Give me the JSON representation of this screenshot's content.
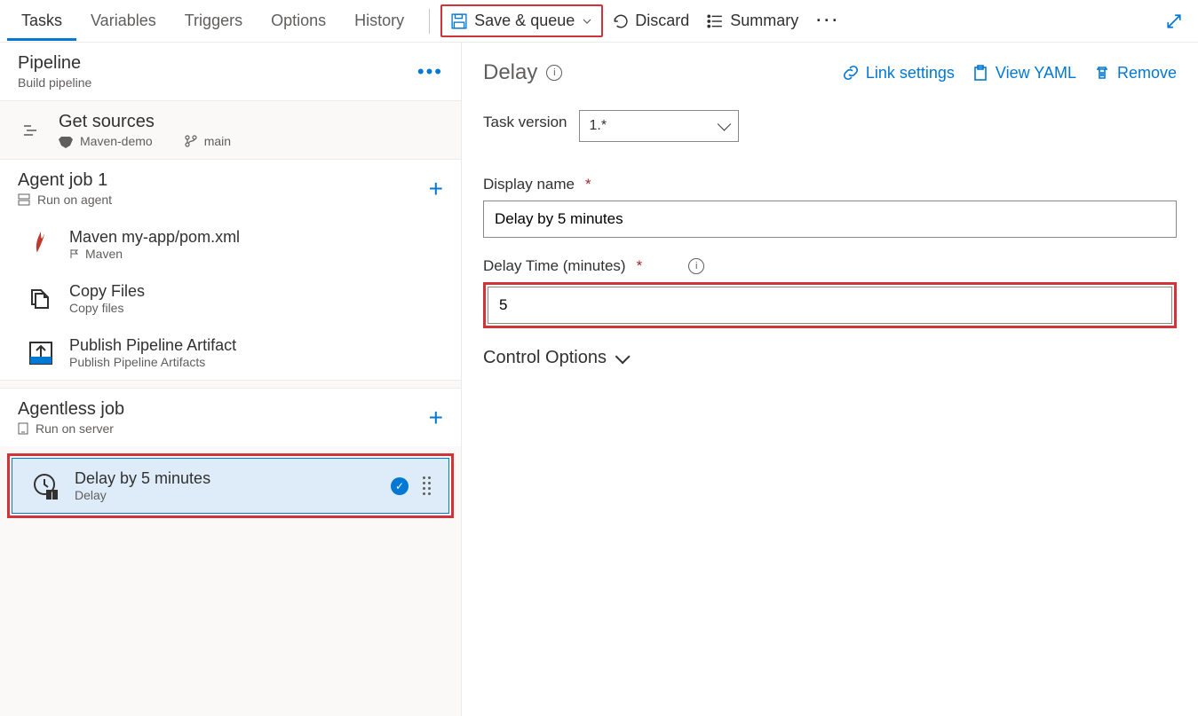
{
  "tabs": [
    "Tasks",
    "Variables",
    "Triggers",
    "Options",
    "History"
  ],
  "active_tab": 0,
  "toolbar": {
    "save_queue": "Save & queue",
    "discard": "Discard",
    "summary": "Summary"
  },
  "pipeline": {
    "title": "Pipeline",
    "subtitle": "Build pipeline"
  },
  "get_sources": {
    "title": "Get sources",
    "repo": "Maven-demo",
    "branch": "main"
  },
  "agent_job": {
    "title": "Agent job 1",
    "subtitle": "Run on agent",
    "tasks": [
      {
        "title": "Maven my-app/pom.xml",
        "subtitle": "Maven",
        "icon": "maven"
      },
      {
        "title": "Copy Files",
        "subtitle": "Copy files",
        "icon": "copy"
      },
      {
        "title": "Publish Pipeline Artifact",
        "subtitle": "Publish Pipeline Artifacts",
        "icon": "publish"
      }
    ]
  },
  "agentless_job": {
    "title": "Agentless job",
    "subtitle": "Run on server",
    "tasks": [
      {
        "title": "Delay by 5 minutes",
        "subtitle": "Delay",
        "icon": "delay"
      }
    ]
  },
  "panel": {
    "title": "Delay",
    "links": {
      "link_settings": "Link settings",
      "view_yaml": "View YAML",
      "remove": "Remove"
    },
    "task_version_label": "Task version",
    "task_version_value": "1.*",
    "display_name_label": "Display name",
    "display_name_value": "Delay by 5 minutes",
    "delay_time_label": "Delay Time (minutes)",
    "delay_time_value": "5",
    "control_options": "Control Options"
  }
}
